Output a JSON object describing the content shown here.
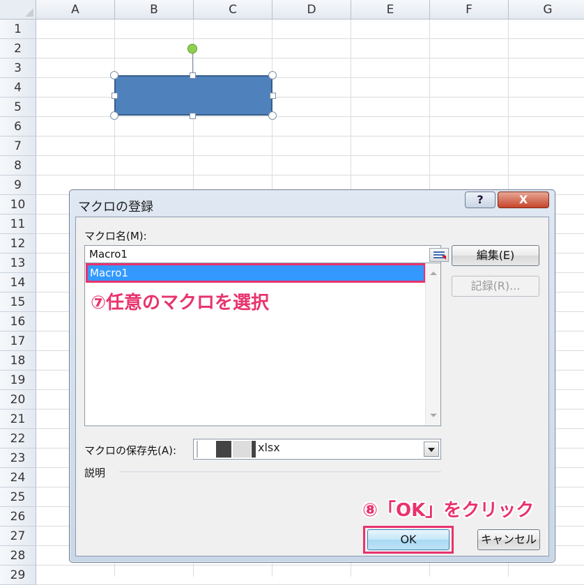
{
  "sheet": {
    "columns": [
      "A",
      "B",
      "C",
      "D",
      "E",
      "F",
      "G"
    ],
    "rows": [
      "1",
      "2",
      "3",
      "4",
      "5",
      "6",
      "7",
      "8",
      "9",
      "10",
      "11",
      "12",
      "13",
      "14",
      "15",
      "16",
      "17",
      "18",
      "19",
      "20",
      "21",
      "22",
      "23",
      "24",
      "25",
      "26",
      "27",
      "28",
      "29"
    ]
  },
  "dialog": {
    "title": "マクロの登録",
    "help_label": "?",
    "close_label": "X",
    "macro_name_label": "マクロ名(M):",
    "macro_name_value": "Macro1",
    "list_items": [
      "Macro1"
    ],
    "store_label": "マクロの保存先(A):",
    "store_value": "xlsx",
    "description_label": "説明",
    "edit_button": "編集(E)",
    "record_button": "記録(R)...",
    "ok_button": "OK",
    "cancel_button": "キャンセル"
  },
  "annotations": {
    "step7": "⑦任意のマクロを選択",
    "step8": "⑧「OK」をクリック",
    "highlight_color": "#e8336d"
  },
  "colors": {
    "shape_fill": "#4f81bd",
    "selection": "#3399ff"
  }
}
